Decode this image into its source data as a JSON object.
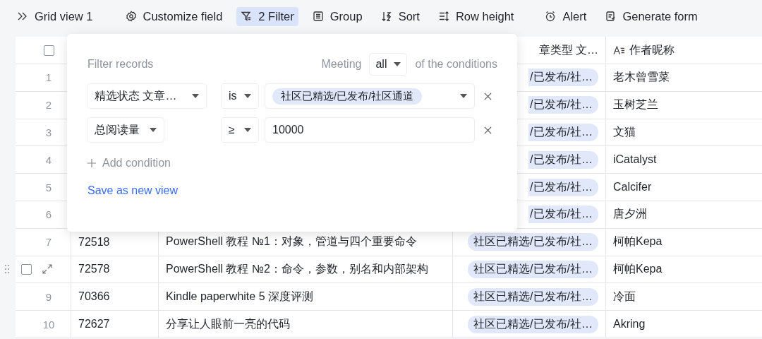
{
  "toolbar": [
    {
      "label": "Grid view 1",
      "selected": false
    },
    {
      "label": "Customize field",
      "selected": false
    },
    {
      "label": "2 Filter",
      "selected": true
    },
    {
      "label": "Group",
      "selected": false
    },
    {
      "label": "Sort",
      "selected": false
    },
    {
      "label": "Row height",
      "selected": false
    },
    {
      "label": "Alert",
      "selected": false
    },
    {
      "label": "Generate form",
      "selected": false
    }
  ],
  "table": {
    "all_checked": false,
    "columns": [
      {
        "label": "章类型 文…"
      },
      {
        "label": "作者昵称"
      }
    ],
    "rows": [
      {
        "number": "1",
        "hovered": false,
        "tag": "/已发布/社…",
        "author": "老木曾雪菜"
      },
      {
        "number": "2",
        "hovered": false,
        "tag": "/已发布/社…",
        "author": "玉树芝兰"
      },
      {
        "number": "3",
        "hovered": false,
        "tag": "/已发布/社…",
        "author": "文猫"
      },
      {
        "number": "4",
        "hovered": false,
        "tag": "/已发布/社…",
        "author": "iCatalyst"
      },
      {
        "number": "5",
        "hovered": false,
        "tag": "/已发布/社…",
        "author": "Calcifer"
      },
      {
        "number": "6",
        "hovered": false,
        "tag": "/已发布/社…",
        "author": "唐夕洲"
      },
      {
        "number": "7",
        "hovered": false,
        "id": "72518",
        "title": "PowerShell 教程 №1：对象，管道与四个重要命令",
        "tag": "社区已精选/已发布/社…",
        "author": "柯帕Kepa"
      },
      {
        "hovered": true,
        "checked": false,
        "id": "72578",
        "title": "PowerShell 教程 №2：命令，参数，别名和内部架构",
        "tag": "社区已精选/已发布/社…",
        "author": "柯帕Kepa"
      },
      {
        "number": "9",
        "hovered": false,
        "id": "70366",
        "title": "Kindle paperwhite 5 深度评测",
        "tag": "社区已精选/已发布/社…",
        "author": "冷面"
      },
      {
        "number": "10",
        "hovered": false,
        "id": "72627",
        "title": "分享让人眼前一亮的代码",
        "tag": "社区已精选/已发布/社…",
        "author": "Akring"
      }
    ]
  },
  "filter_popover": {
    "title": "Filter records",
    "meeting_label": "Meeting",
    "match": "all",
    "suffix": "of the conditions",
    "conditions": [
      {
        "field": "精选状态 文章…",
        "operator": "is",
        "kind": "tag",
        "value": "社区已精选/已发布/社区通道"
      },
      {
        "field": "总阅读量",
        "operator": "≥",
        "kind": "text",
        "value": "10000"
      }
    ],
    "add_label": "Add condition",
    "save_link": "Save as new view"
  }
}
